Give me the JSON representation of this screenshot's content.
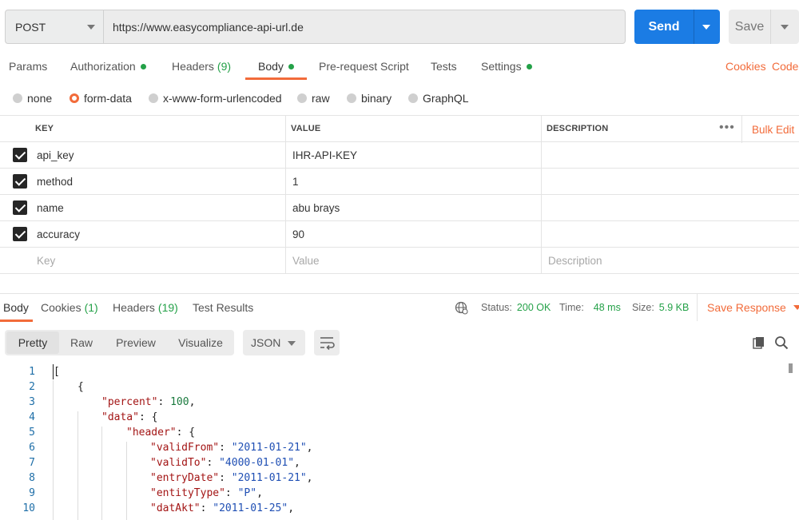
{
  "request": {
    "method": "POST",
    "url": "https://www.easycompliance-api-url.de",
    "send_label": "Send",
    "save_label": "Save"
  },
  "request_tabs": {
    "params": "Params",
    "authorization": "Authorization",
    "headers": "Headers",
    "headers_count": "(9)",
    "body": "Body",
    "prerequest": "Pre-request Script",
    "tests": "Tests",
    "settings": "Settings",
    "cookies": "Cookies",
    "code": "Code"
  },
  "body_types": {
    "none": "none",
    "form_data": "form-data",
    "urlencoded": "x-www-form-urlencoded",
    "raw": "raw",
    "binary": "binary",
    "graphql": "GraphQL",
    "selected": "form-data"
  },
  "params_table": {
    "columns": {
      "key": "KEY",
      "value": "VALUE",
      "description": "DESCRIPTION"
    },
    "bulk_edit": "Bulk Edit",
    "more": "•••",
    "rows": [
      {
        "key": "api_key",
        "value": "IHR-API-KEY",
        "description": ""
      },
      {
        "key": "method",
        "value": "1",
        "description": ""
      },
      {
        "key": "name",
        "value": "abu brays",
        "description": ""
      },
      {
        "key": "accuracy",
        "value": "90",
        "description": ""
      }
    ],
    "placeholders": {
      "key": "Key",
      "value": "Value",
      "description": "Description"
    }
  },
  "response": {
    "tabs": {
      "body": "Body",
      "cookies": "Cookies",
      "cookies_count": "(1)",
      "headers": "Headers",
      "headers_count": "(19)",
      "test_results": "Test Results"
    },
    "status_label": "Status:",
    "status_value": "200 OK",
    "time_label": "Time:",
    "time_value": "48 ms",
    "size_label": "Size:",
    "size_value": "5.9 KB",
    "save_response": "Save Response"
  },
  "view": {
    "modes": [
      "Pretty",
      "Raw",
      "Preview",
      "Visualize"
    ],
    "active_mode": "Pretty",
    "format": "JSON"
  },
  "code_lines": [
    {
      "n": "1",
      "text": "["
    },
    {
      "n": "2",
      "text": "{"
    },
    {
      "n": "3",
      "key": "\"percent\"",
      "val": "100",
      "vtype": "num",
      "trail": ","
    },
    {
      "n": "4",
      "key": "\"data\"",
      "val": "{",
      "vtype": "punct",
      "trail": ""
    },
    {
      "n": "5",
      "key": "\"header\"",
      "val": "{",
      "vtype": "punct",
      "trail": ""
    },
    {
      "n": "6",
      "key": "\"validFrom\"",
      "val": "\"2011-01-21\"",
      "vtype": "str",
      "trail": ","
    },
    {
      "n": "7",
      "key": "\"validTo\"",
      "val": "\"4000-01-01\"",
      "vtype": "str",
      "trail": ","
    },
    {
      "n": "8",
      "key": "\"entryDate\"",
      "val": "\"2011-01-21\"",
      "vtype": "str",
      "trail": ","
    },
    {
      "n": "9",
      "key": "\"entityType\"",
      "val": "\"P\"",
      "vtype": "str",
      "trail": ","
    },
    {
      "n": "10",
      "key": "\"datAkt\"",
      "val": "\"2011-01-25\"",
      "vtype": "str",
      "trail": ","
    }
  ],
  "colors": {
    "accent": "#f26b3a",
    "send": "#1b7ce4",
    "success": "#24a148",
    "json_key": "#a31515",
    "json_string": "#1f4fb4",
    "json_number": "#1a7a3e",
    "line_number": "#1f6fa8"
  }
}
